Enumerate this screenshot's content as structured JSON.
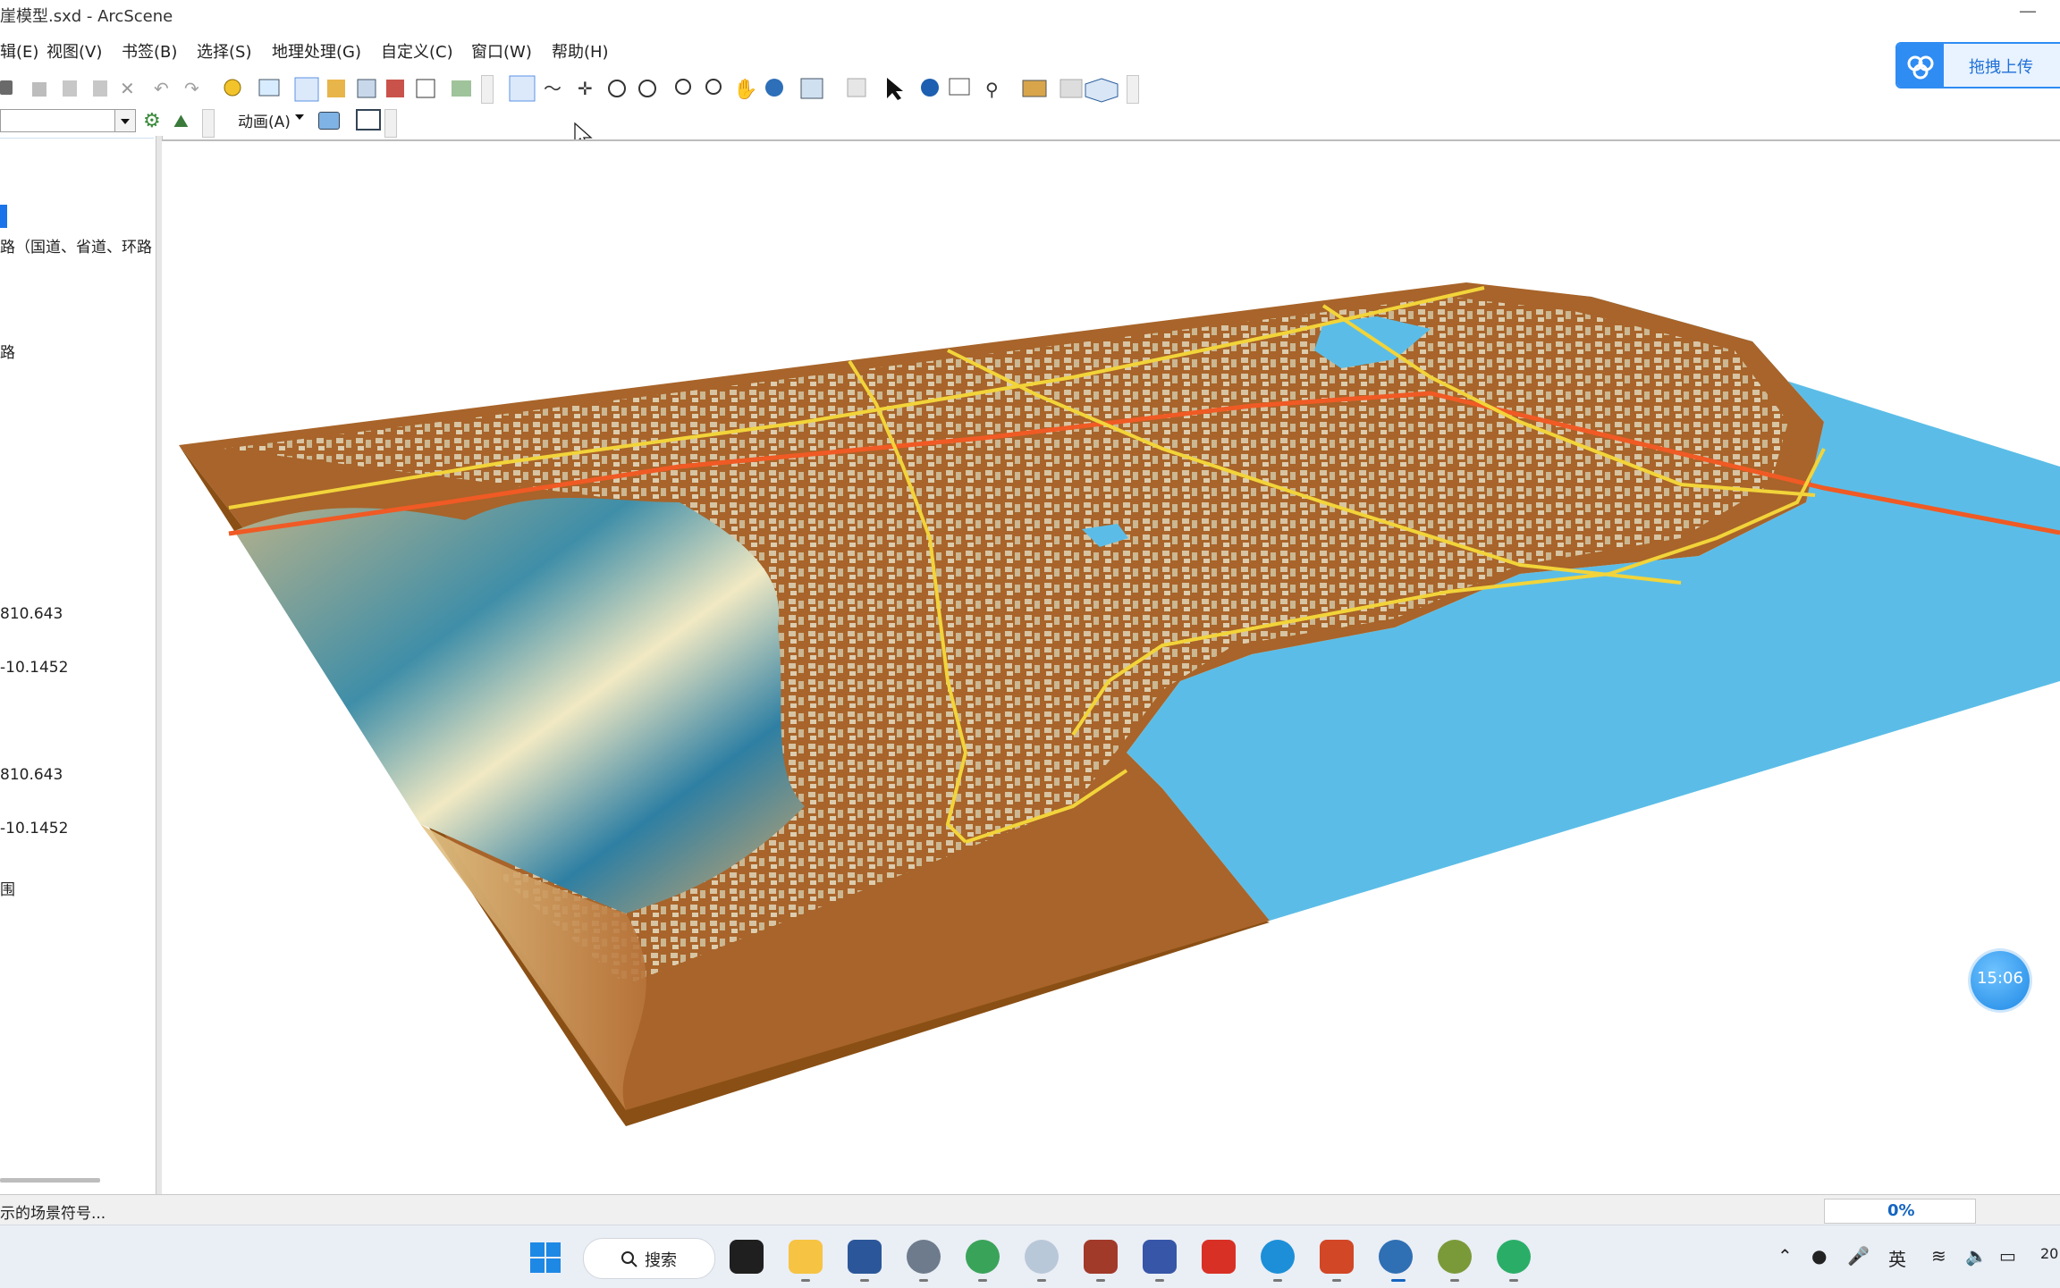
{
  "window": {
    "title": "崖模型.sxd - ArcScene",
    "minimize": "—"
  },
  "menu": [
    "辑(E)",
    "视图(V)",
    "书签(B)",
    "选择(S)",
    "地理处理(G)",
    "自定义(C)",
    "窗口(W)",
    "帮助(H)"
  ],
  "upload_button": {
    "label": "拖拽上传"
  },
  "toolbar2": {
    "animation_label": "动画(A)"
  },
  "toc": {
    "pin": "ᵽ",
    "close": "✕",
    "items": [
      {
        "text": "路（国道、省道、环路"
      },
      {
        "text": "路"
      },
      {
        "text": "810.643"
      },
      {
        "text": "-10.1452"
      },
      {
        "text": "810.643"
      },
      {
        "text": "-10.1452"
      },
      {
        "text": "围"
      }
    ]
  },
  "status": {
    "message": "示的场景符号...",
    "progress": "0%"
  },
  "taskbar": {
    "search_label": "搜索",
    "ime": "英",
    "year_fragment": "20"
  },
  "clock_bubble": "15:06",
  "colors": {
    "water": "#5bbde7",
    "land": "#a8642a",
    "buildings": "#d7c6a7",
    "major_road": "#f2d43a",
    "rail": "#f05a24",
    "accent": "#2f8cf3"
  }
}
